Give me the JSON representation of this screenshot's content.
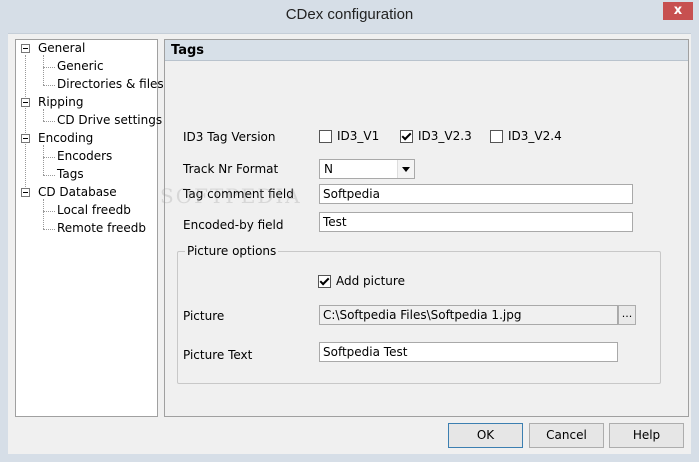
{
  "window": {
    "title": "CDex configuration",
    "close_label": "x"
  },
  "tree": {
    "items": [
      {
        "label": "General",
        "expanded": true
      },
      {
        "label": "Generic"
      },
      {
        "label": "Directories & files"
      },
      {
        "label": "Ripping",
        "expanded": true
      },
      {
        "label": "CD Drive settings"
      },
      {
        "label": "Encoding",
        "expanded": true
      },
      {
        "label": "Encoders"
      },
      {
        "label": "Tags",
        "selected": true
      },
      {
        "label": "CD Database",
        "expanded": true
      },
      {
        "label": "Local freedb"
      },
      {
        "label": "Remote freedb"
      }
    ]
  },
  "panel": {
    "title": "Tags",
    "id3_version_label": "ID3 Tag Version",
    "id3_options": [
      {
        "label": "ID3_V1",
        "checked": false
      },
      {
        "label": "ID3_V2.3",
        "checked": true
      },
      {
        "label": "ID3_V2.4",
        "checked": false
      }
    ],
    "track_nr_label": "Track Nr Format",
    "track_nr_value": "N",
    "tag_comment_label": "Tag comment field",
    "tag_comment_value": "Softpedia",
    "encoded_by_label": "Encoded-by field",
    "encoded_by_value": "Test",
    "picture_group": {
      "legend": "Picture options",
      "add_picture_label": "Add picture",
      "add_picture_checked": true,
      "picture_label": "Picture",
      "picture_value": "C:\\Softpedia Files\\Softpedia 1.jpg",
      "browse_label": "...",
      "picture_text_label": "Picture Text",
      "picture_text_value": "Softpedia Test"
    }
  },
  "buttons": {
    "ok": "OK",
    "cancel": "Cancel",
    "help": "Help"
  },
  "watermark": "SOFTPEDIA"
}
